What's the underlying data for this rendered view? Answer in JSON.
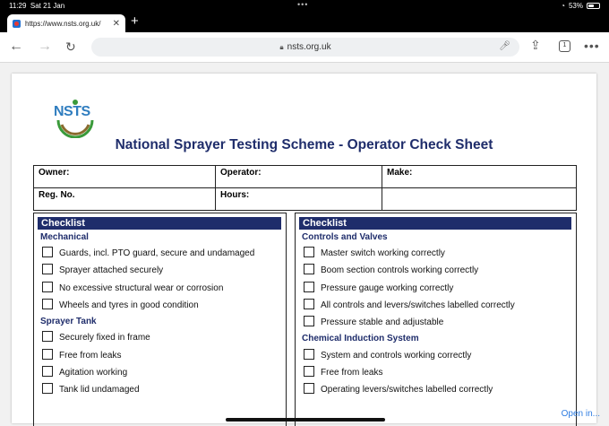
{
  "status": {
    "time": "11:29",
    "date": "Sat 21 Jan",
    "battery": "53%",
    "battery_level": 0.53
  },
  "tab": {
    "url": "https://www.nsts.org.uk/"
  },
  "toolbar": {
    "address": "nsts.org.uk",
    "tab_count": "1"
  },
  "document": {
    "logo_text": "NSTS",
    "title": "National Sprayer Testing Scheme - Operator Check Sheet",
    "info": [
      [
        "Owner:",
        "Operator:",
        "Make:"
      ],
      [
        "Reg. No.",
        "Hours:",
        ""
      ]
    ],
    "left": {
      "header": "Checklist",
      "sections": [
        {
          "title": "Mechanical",
          "items": [
            "Guards, incl. PTO guard, secure and undamaged",
            "Sprayer attached securely",
            "No excessive structural wear or corrosion",
            "Wheels and tyres in good condition"
          ]
        },
        {
          "title": "Sprayer Tank",
          "items": [
            "Securely fixed in frame",
            "Free from leaks",
            "Agitation working",
            "Tank lid undamaged"
          ]
        }
      ]
    },
    "right": {
      "header": "Checklist",
      "sections": [
        {
          "title": "Controls and Valves",
          "items": [
            "Master switch working correctly",
            "Boom section controls working correctly",
            "Pressure gauge working correctly",
            "All controls and levers/switches labelled correctly",
            "Pressure stable and adjustable"
          ]
        },
        {
          "title": "Chemical Induction System",
          "items": [
            "System and controls working correctly",
            "Free from leaks",
            "Operating levers/switches labelled correctly"
          ]
        }
      ]
    }
  },
  "footer": {
    "open_in": "Open in..."
  }
}
